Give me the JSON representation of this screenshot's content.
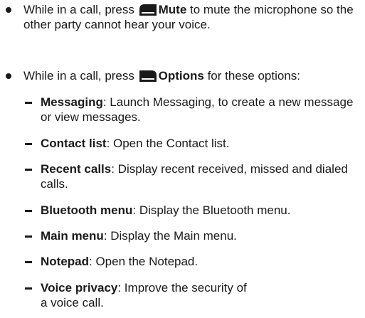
{
  "bullets": [
    {
      "prefix": "While in a call, press ",
      "key_icon": "left-softkey-icon",
      "key_label": "Mute",
      "suffix": " to mute the microphone so the other party cannot hear your voice."
    },
    {
      "prefix": "While in a call, press ",
      "key_icon": "right-softkey-icon",
      "key_label": "Options",
      "suffix": " for these options:"
    }
  ],
  "options": [
    {
      "term": "Messaging",
      "desc": ": Launch Messaging, to create a new message or view messages."
    },
    {
      "term": "Contact list",
      "desc": ": Open the Contact list."
    },
    {
      "term": "Recent calls",
      "desc": ": Display recent received, missed and dialed calls."
    },
    {
      "term": "Bluetooth menu",
      "desc": ": Display the Bluetooth menu."
    },
    {
      "term": "Main menu",
      "desc": ": Display the Main menu."
    },
    {
      "term": "Notepad",
      "desc": ": Open the Notepad."
    },
    {
      "term": "Voice privacy",
      "desc": ": Improve the security of a voice call."
    }
  ],
  "colors": {
    "text": "#1a1a1a",
    "background": "#ffffff"
  }
}
